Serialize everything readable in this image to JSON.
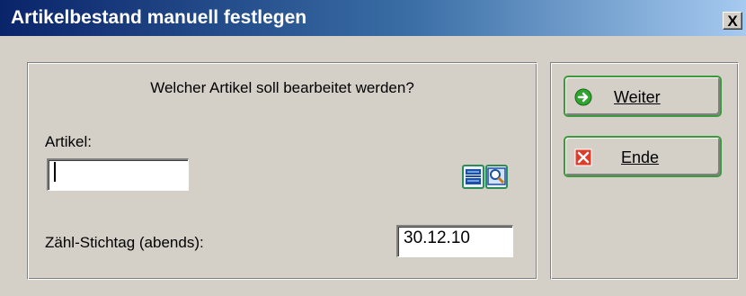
{
  "window": {
    "title": "Artikelbestand manuell festlegen",
    "close_label": "X"
  },
  "form": {
    "question": "Welcher Artikel soll bearbeitet werden?",
    "artikel_label": "Artikel:",
    "artikel_value": "",
    "stichtag_label": "Zähl-Stichtag (abends):",
    "stichtag_value": "30.12.10"
  },
  "tools": [
    {
      "icon": "list-icon"
    },
    {
      "icon": "search-icon"
    }
  ],
  "buttons": {
    "weiter_label": "Weiter",
    "weiter_icon": "green-arrow-right-icon",
    "ende_label": "Ende",
    "ende_icon": "red-x-icon"
  },
  "colors": {
    "title_start": "#0a246a",
    "title_end": "#a6caf0",
    "window_bg": "#d4d0c8",
    "button_border": "#3c9a3c",
    "accent_green": "#2fa52f",
    "accent_red": "#e03a2a"
  }
}
